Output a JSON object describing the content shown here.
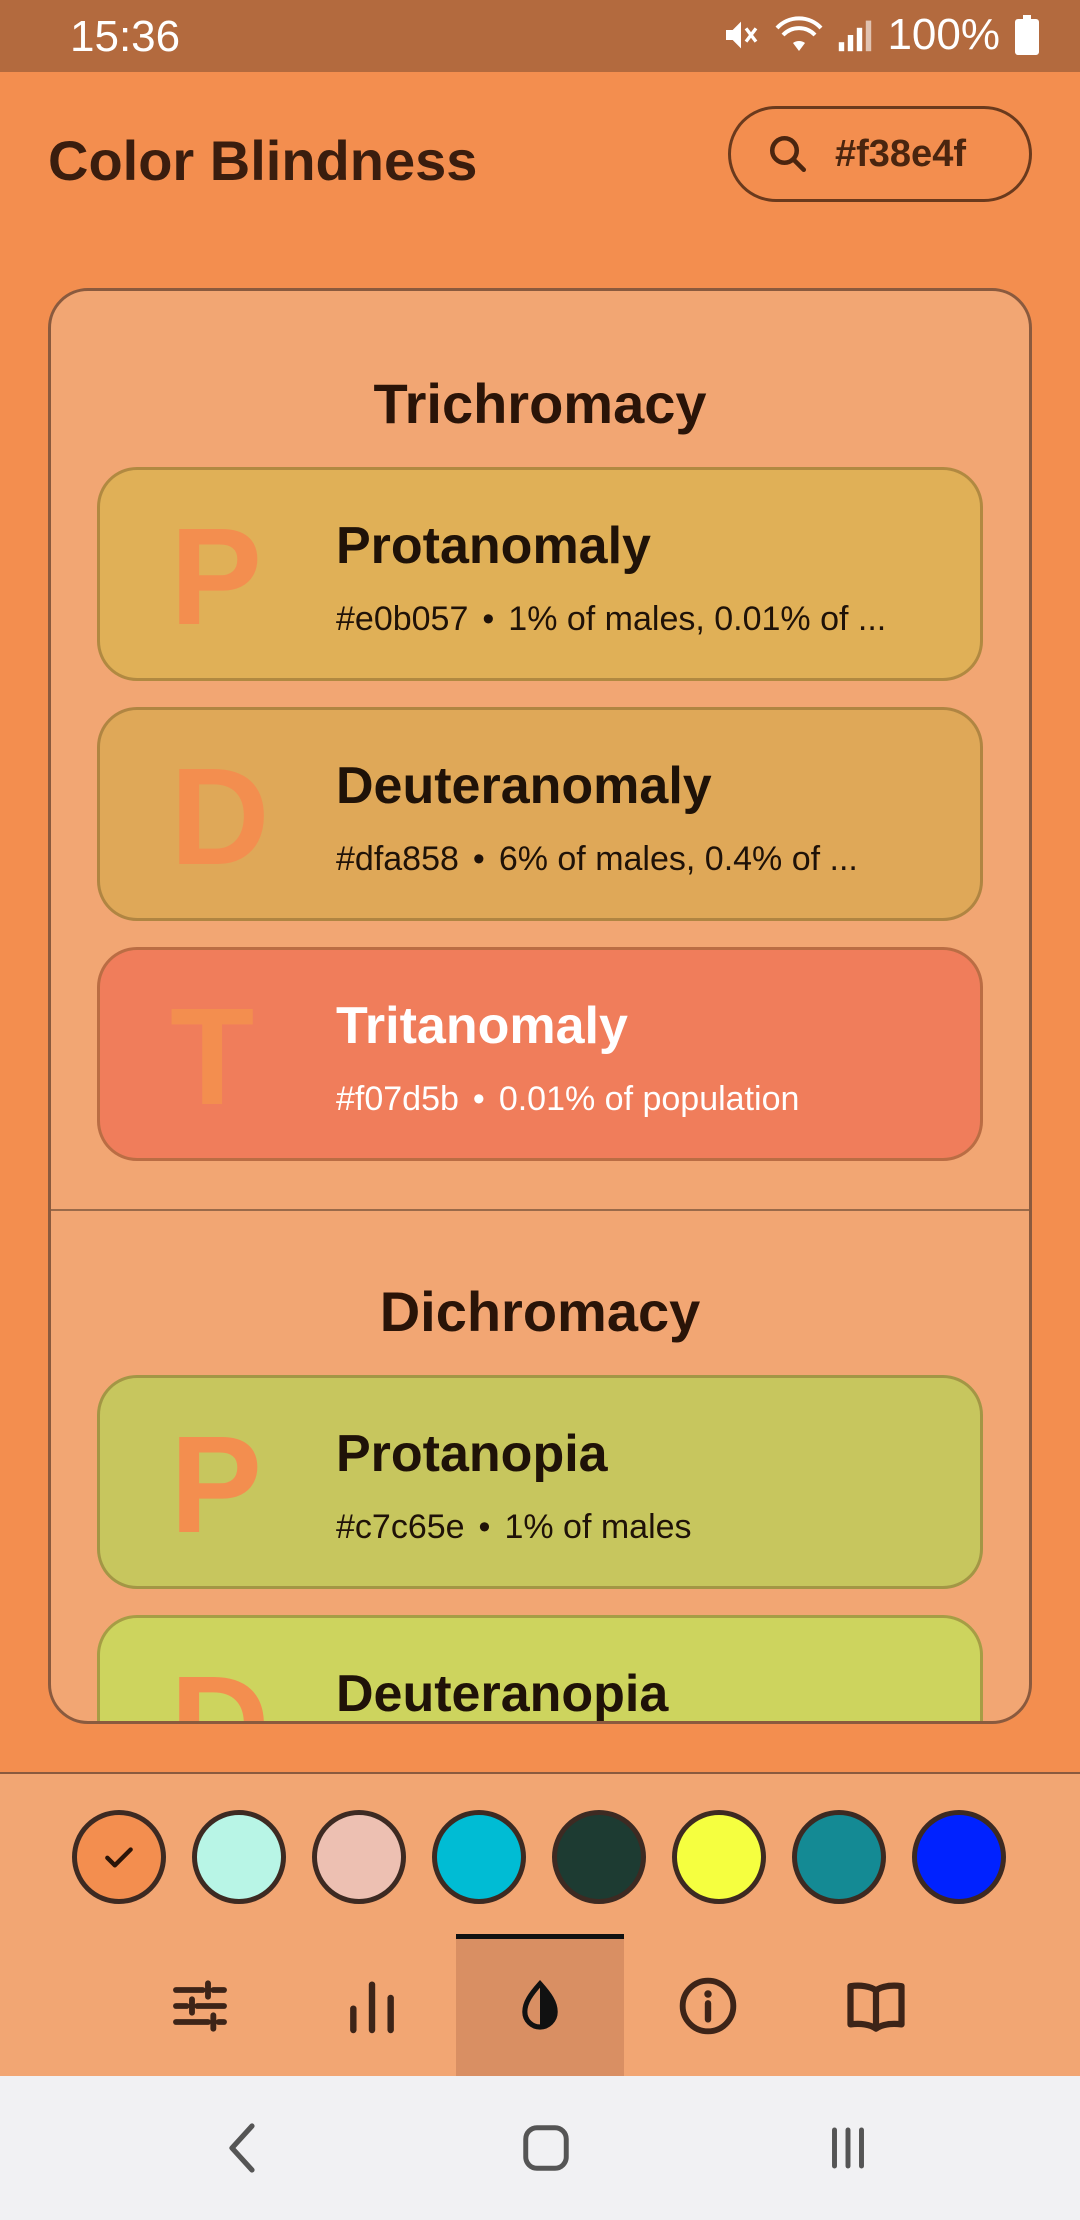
{
  "status_bar": {
    "time": "15:36",
    "battery": "100%"
  },
  "header": {
    "title": "Color Blindness",
    "search_value": "#f38e4f"
  },
  "sections": [
    {
      "title": "Trichromacy",
      "items": [
        {
          "letter": "P",
          "name": "Protanomaly",
          "hex": "#e0b057",
          "desc": "1% of males, 0.01% of ...",
          "color": "#e0b057",
          "text_color": "#1f1208"
        },
        {
          "letter": "D",
          "name": "Deuteranomaly",
          "hex": "#dfa858",
          "desc": "6% of males, 0.4% of ...",
          "color": "#dfa858",
          "text_color": "#1f1208"
        },
        {
          "letter": "T",
          "name": "Tritanomaly",
          "hex": "#f07d5b",
          "desc": "0.01% of population",
          "color": "#f07d5b",
          "text_color": "#ffffff"
        }
      ]
    },
    {
      "title": "Dichromacy",
      "items": [
        {
          "letter": "P",
          "name": "Protanopia",
          "hex": "#c7c65e",
          "desc": "1% of males",
          "color": "#c7c65e",
          "text_color": "#1f1208"
        },
        {
          "letter": "D",
          "name": "Deuteranopia",
          "hex": "",
          "desc": "",
          "color": "#cdd45e",
          "text_color": "#1f1208"
        }
      ]
    }
  ],
  "swatches": [
    {
      "color": "#f38e4f",
      "selected": true
    },
    {
      "color": "#b8f5e6",
      "selected": false
    },
    {
      "color": "#edc0b2",
      "selected": false
    },
    {
      "color": "#00bcd4",
      "selected": false
    },
    {
      "color": "#1d3b32",
      "selected": false
    },
    {
      "color": "#f5ff40",
      "selected": false
    },
    {
      "color": "#148a94",
      "selected": false
    },
    {
      "color": "#0022ff",
      "selected": false
    }
  ],
  "bottom_nav": [
    {
      "icon": "sliders-icon",
      "active": false
    },
    {
      "icon": "bar-chart-icon",
      "active": false
    },
    {
      "icon": "contrast-drop-icon",
      "active": true
    },
    {
      "icon": "info-icon",
      "active": false
    },
    {
      "icon": "book-icon",
      "active": false
    }
  ]
}
